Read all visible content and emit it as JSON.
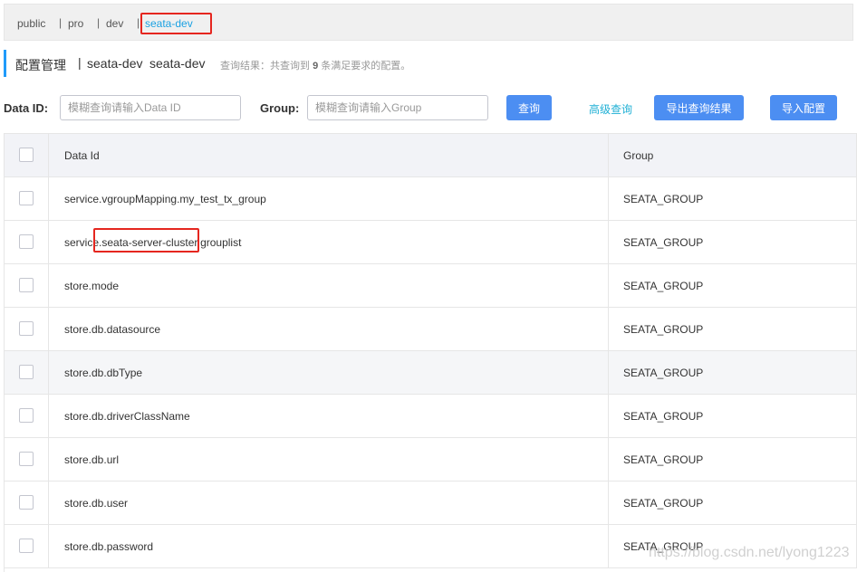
{
  "namespaces": {
    "items": [
      "public",
      "pro",
      "dev",
      "seata-dev"
    ],
    "separator": "|"
  },
  "title": {
    "main": "配置管理",
    "separator": "|",
    "namespace_name": "seata-dev",
    "namespace_id": "seata-dev",
    "hint_prefix": "查询结果：共查询到",
    "hint_count": "9",
    "hint_suffix": "条满足要求的配置。"
  },
  "search": {
    "dataid_label": "Data ID:",
    "dataid_placeholder": "模糊查询请输入Data ID",
    "group_label": "Group:",
    "group_placeholder": "模糊查询请输入Group",
    "query_button": "查询",
    "advanced_link": "高级查询",
    "export_button": "导出查询结果",
    "import_button": "导入配置"
  },
  "table": {
    "columns": [
      "Data Id",
      "Group"
    ],
    "rows": [
      {
        "data_id": "service.vgroupMapping.my_test_tx_group",
        "group": "SEATA_GROUP"
      },
      {
        "data_id_parts": [
          "servic",
          "e.",
          "seata-server-cluster",
          ".grouplist"
        ],
        "data_id": "service.seata-server-cluster.grouplist",
        "group": "SEATA_GROUP"
      },
      {
        "data_id": "store.mode",
        "group": "SEATA_GROUP"
      },
      {
        "data_id": "store.db.datasource",
        "group": "SEATA_GROUP"
      },
      {
        "data_id": "store.db.dbType",
        "group": "SEATA_GROUP"
      },
      {
        "data_id": "store.db.driverClassName",
        "group": "SEATA_GROUP"
      },
      {
        "data_id": "store.db.url",
        "group": "SEATA_GROUP"
      },
      {
        "data_id": "store.db.user",
        "group": "SEATA_GROUP"
      },
      {
        "data_id": "store.db.password",
        "group": "SEATA_GROUP"
      }
    ]
  },
  "watermark": "https://blog.csdn.net/lyong1223",
  "colors": {
    "accent": "#4c8ef2",
    "link": "#20b0d5",
    "active_namespace": "#1ba1e2",
    "highlight_box": "#e5261f"
  }
}
